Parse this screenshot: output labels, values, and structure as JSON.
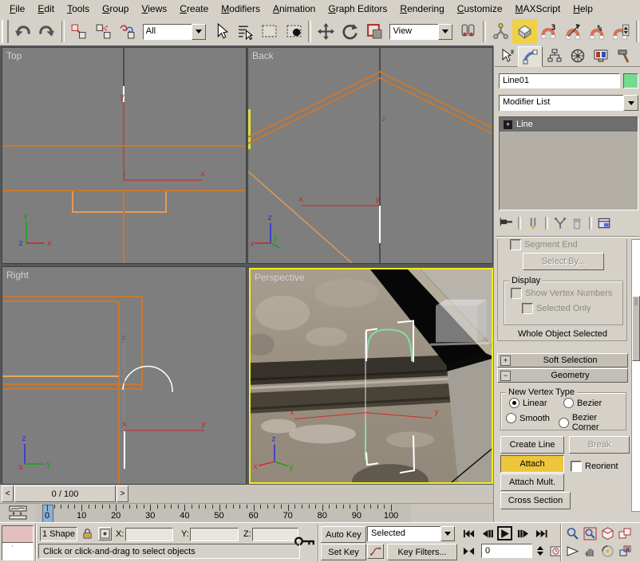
{
  "menu": {
    "items": [
      "File",
      "Edit",
      "Tools",
      "Group",
      "Views",
      "Create",
      "Modifiers",
      "Animation",
      "Graph Editors",
      "Rendering",
      "Customize",
      "MAXScript",
      "Help"
    ]
  },
  "toolbar": {
    "selection_filter_value": "All",
    "coordinate_system_value": "View"
  },
  "viewports": {
    "top": "Top",
    "back": "Back",
    "right": "Right",
    "perspective": "Perspective"
  },
  "command_panel": {
    "object_name": "Line01",
    "modifier_list_label": "Modifier List",
    "stack_item": "Line",
    "segment_end_label": "Segment End",
    "select_by_label": "Select By...",
    "display_group_label": "Display",
    "show_vertex_numbers_label": "Show Vertex Numbers",
    "selected_only_label": "Selected Only",
    "whole_object_label": "Whole Object Selected",
    "soft_selection_label": "Soft Selection",
    "geometry_label": "Geometry",
    "new_vertex_type_label": "New Vertex Type",
    "vertex_type_options": [
      "Linear",
      "Bezier",
      "Smooth",
      "Bezier Corner"
    ],
    "selected_vertex_type": "Linear",
    "buttons": {
      "create_line": "Create Line",
      "break": "Break",
      "attach": "Attach",
      "reorient": "Reorient",
      "attach_mult": "Attach Mult.",
      "cross_section": "Cross Section"
    }
  },
  "timeline": {
    "slider_label": "0 / 100",
    "frame_ticks": [
      0,
      10,
      20,
      30,
      40,
      50,
      60,
      70,
      80,
      90,
      100
    ],
    "current_frame_marker": "0"
  },
  "status_bar": {
    "selection_status": "1 Shape",
    "coord_labels": {
      "x": "X:",
      "y": "Y:",
      "z": "Z:"
    },
    "coord_values": {
      "x": "",
      "y": "",
      "z": ""
    },
    "prompt": "Click or click-and-drag to select objects",
    "auto_key": "Auto Key",
    "set_key": "Set Key",
    "key_filter_scope": "Selected",
    "key_filters": "Key Filters...",
    "current_frame": "0"
  },
  "colors": {
    "active_viewport_border": "#f6ec13",
    "attach_active_bg": "#eec63b",
    "snap_toggle_active_bg": "#f0d145",
    "object_color_swatch": "#75db8f",
    "spline_orange": "#c87830",
    "selected_spline": "#ffffff",
    "axis_red": "#cc2424",
    "arch_green": "#7fe2a2"
  }
}
